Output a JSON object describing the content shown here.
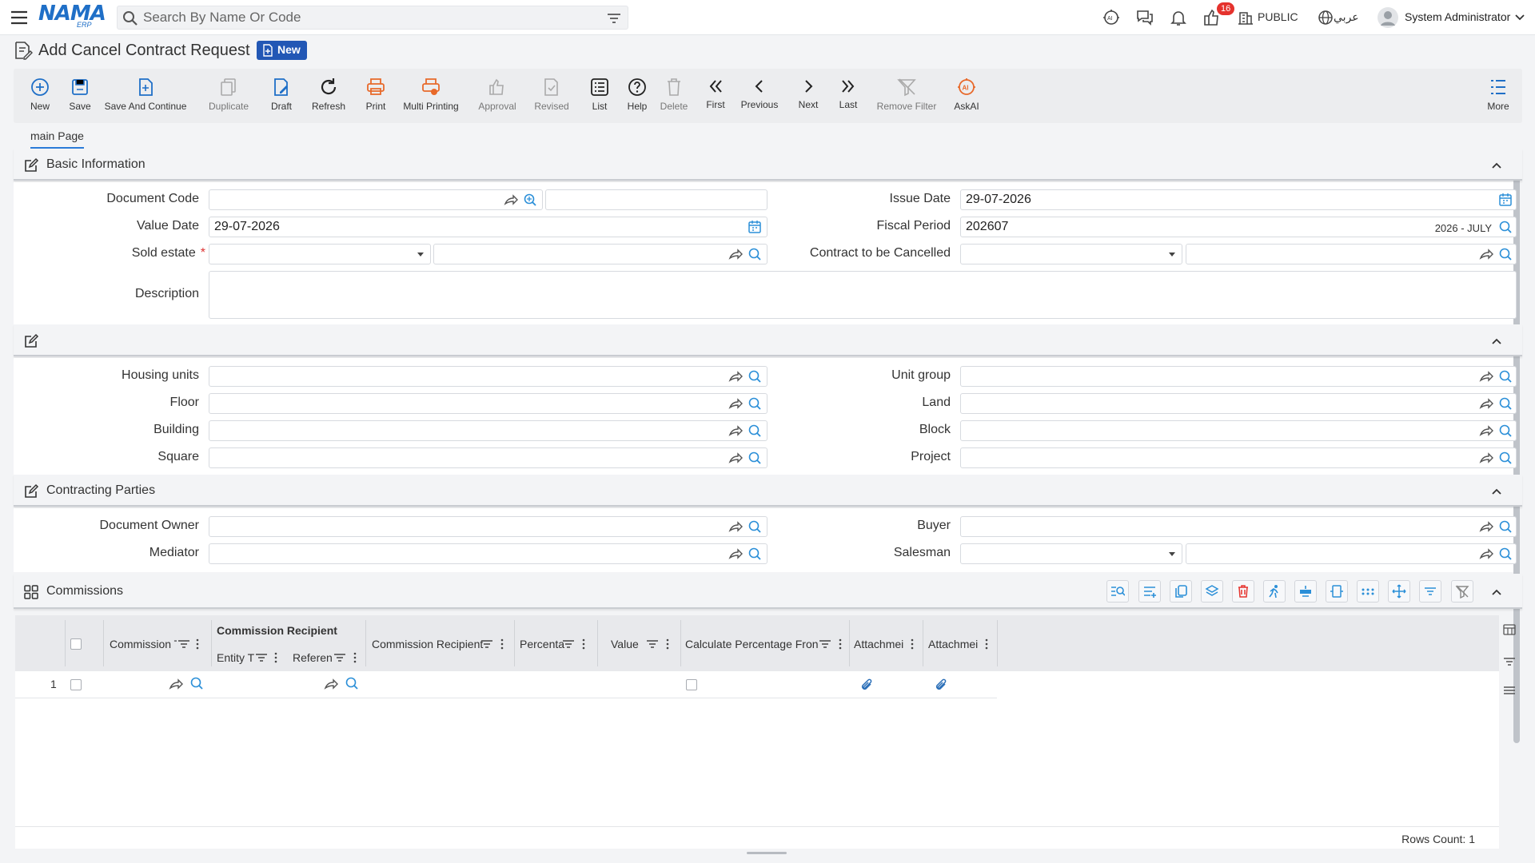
{
  "app": {
    "logo_text": "NAMA",
    "logo_sub": "ERP"
  },
  "search": {
    "placeholder": "Search By Name Or Code"
  },
  "topbar": {
    "notification_count": "16",
    "org": "PUBLIC",
    "language": "عربي",
    "user": "System Administrator"
  },
  "page": {
    "title": "Add Cancel Contract Request",
    "mode_badge": "New"
  },
  "toolbar": [
    {
      "label": "New",
      "icon": "add-circle-icon"
    },
    {
      "label": "Save",
      "icon": "save-icon"
    },
    {
      "label": "Save And Continue",
      "icon": "save-continue-icon"
    },
    {
      "label": "Duplicate",
      "icon": "duplicate-icon"
    },
    {
      "label": "Draft",
      "icon": "draft-icon"
    },
    {
      "label": "Refresh",
      "icon": "refresh-icon"
    },
    {
      "label": "Print",
      "icon": "print-icon"
    },
    {
      "label": "Multi Printing",
      "icon": "multi-print-icon"
    },
    {
      "label": "Approval",
      "icon": "approval-icon"
    },
    {
      "label": "Revised",
      "icon": "revised-icon"
    },
    {
      "label": "List",
      "icon": "list-icon"
    },
    {
      "label": "Help",
      "icon": "help-icon"
    },
    {
      "label": "Delete",
      "icon": "delete-icon"
    },
    {
      "label": "First",
      "icon": "first-icon"
    },
    {
      "label": "Previous",
      "icon": "previous-icon"
    },
    {
      "label": "Next",
      "icon": "next-icon"
    },
    {
      "label": "Last",
      "icon": "last-icon"
    },
    {
      "label": "Remove Filter",
      "icon": "remove-filter-icon"
    },
    {
      "label": "AskAI",
      "icon": "ask-ai-icon"
    },
    {
      "label": "More",
      "icon": "more-icon"
    }
  ],
  "tabs": [
    {
      "label": "main Page"
    }
  ],
  "sections": {
    "basic": {
      "title": "Basic Information"
    },
    "units": {
      "title": ""
    },
    "parties": {
      "title": "Contracting Parties"
    },
    "commissions": {
      "title": "Commissions"
    }
  },
  "basic": {
    "document_code": {
      "label": "Document Code",
      "value": ""
    },
    "issue_date": {
      "label": "Issue Date",
      "value": "29-07-2026"
    },
    "value_date": {
      "label": "Value Date",
      "value": "29-07-2026"
    },
    "fiscal_period": {
      "label": "Fiscal Period",
      "value": "202607",
      "period_name": "2026 - JULY"
    },
    "sold_estate": {
      "label": "Sold estate",
      "required": "*"
    },
    "contract_cancelled": {
      "label": "Contract to be Cancelled"
    },
    "description": {
      "label": "Description",
      "value": ""
    }
  },
  "units": {
    "housing_units": {
      "label": "Housing units"
    },
    "unit_group": {
      "label": "Unit group"
    },
    "floor": {
      "label": "Floor"
    },
    "land": {
      "label": "Land"
    },
    "building": {
      "label": "Building"
    },
    "block": {
      "label": "Block"
    },
    "square": {
      "label": "Square"
    },
    "project": {
      "label": "Project"
    }
  },
  "parties": {
    "document_owner": {
      "label": "Document Owner"
    },
    "buyer": {
      "label": "Buyer"
    },
    "mediator": {
      "label": "Mediator"
    },
    "salesman": {
      "label": "Salesman"
    }
  },
  "grid": {
    "group_header": "Commission Recipient",
    "columns": [
      "Commission T",
      "Entity T",
      "Referen",
      "Commission Recipient",
      "Percenta",
      "Value",
      "Calculate Percentage Fron",
      "Attachmei",
      "Attachmei"
    ],
    "rows": [
      {
        "num": "1"
      }
    ],
    "rows_count": "Rows Count: 1"
  }
}
